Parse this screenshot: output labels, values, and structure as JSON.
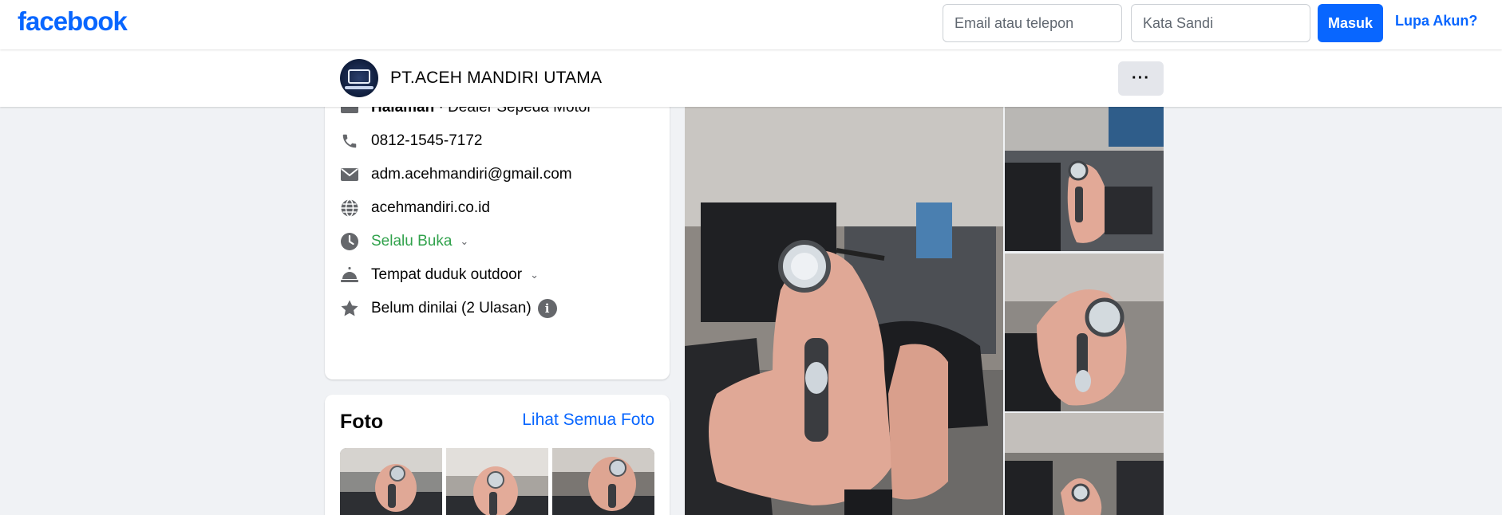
{
  "topbar": {
    "logo": "facebook",
    "email_placeholder": "Email atau telepon",
    "password_placeholder": "Kata Sandi",
    "login_label": "Masuk",
    "forgot_label": "Lupa Akun?"
  },
  "page": {
    "name": "PT.ACEH MANDIRI UTAMA",
    "more_label": "···"
  },
  "intro": {
    "category_bold": "Halaman",
    "category_rest": " · Dealer Sepeda Motor",
    "phone": "0812-1545-7172",
    "email": "adm.acehmandiri@gmail.com",
    "website": "acehmandiri.co.id",
    "hours": "Selalu Buka",
    "amenity": "Tempat duduk outdoor",
    "rating": "Belum dinilai (2 Ulasan)"
  },
  "photos": {
    "title": "Foto",
    "see_all": "Lihat Semua Foto"
  },
  "colors": {
    "brand": "#0866ff",
    "open_status": "#31a24c",
    "scooter": "#e0a896"
  }
}
